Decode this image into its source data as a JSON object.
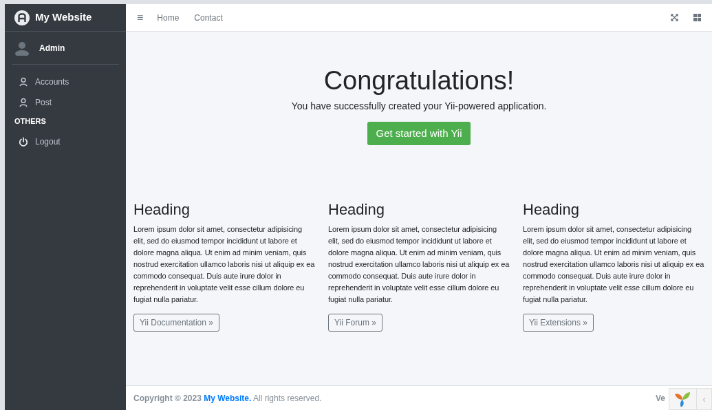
{
  "brand": {
    "title": "My Website"
  },
  "user": {
    "name": "Admin"
  },
  "sidebar": {
    "items": [
      {
        "kind": "user",
        "label": "Accounts"
      },
      {
        "kind": "user",
        "label": "Post"
      },
      {
        "kind": "header",
        "label": "OTHERS"
      },
      {
        "kind": "power",
        "label": "Logout"
      }
    ]
  },
  "navbar": {
    "menu_icon": "≡",
    "links": [
      "Home",
      "Contact"
    ]
  },
  "jumbotron": {
    "title": "Congratulations!",
    "lead": "You have successfully created your Yii-powered application.",
    "button": "Get started with Yii"
  },
  "columns": [
    {
      "heading": "Heading",
      "text": "Lorem ipsum dolor sit amet, consectetur adipisicing elit, sed do eiusmod tempor incididunt ut labore et dolore magna aliqua. Ut enim ad minim veniam, quis nostrud exercitation ullamco laboris nisi ut aliquip ex ea commodo consequat. Duis aute irure dolor in reprehenderit in voluptate velit esse cillum dolore eu fugiat nulla pariatur.",
      "button": "Yii Documentation »"
    },
    {
      "heading": "Heading",
      "text": "Lorem ipsum dolor sit amet, consectetur adipisicing elit, sed do eiusmod tempor incididunt ut labore et dolore magna aliqua. Ut enim ad minim veniam, quis nostrud exercitation ullamco laboris nisi ut aliquip ex ea commodo consequat. Duis aute irure dolor in reprehenderit in voluptate velit esse cillum dolore eu fugiat nulla pariatur.",
      "button": "Yii Forum »"
    },
    {
      "heading": "Heading",
      "text": "Lorem ipsum dolor sit amet, consectetur adipisicing elit, sed do eiusmod tempor incididunt ut labore et dolore magna aliqua. Ut enim ad minim veniam, quis nostrud exercitation ullamco laboris nisi ut aliquip ex ea commodo consequat. Duis aute irure dolor in reprehenderit in voluptate velit esse cillum dolore eu fugiat nulla pariatur.",
      "button": "Yii Extensions »"
    }
  ],
  "footer": {
    "prefix": "Copyright © 2023",
    "link": "My Website.",
    "suffix": "All rights reserved.",
    "right": "Ve"
  },
  "debug_toolbar": {
    "toggle": "‹"
  }
}
